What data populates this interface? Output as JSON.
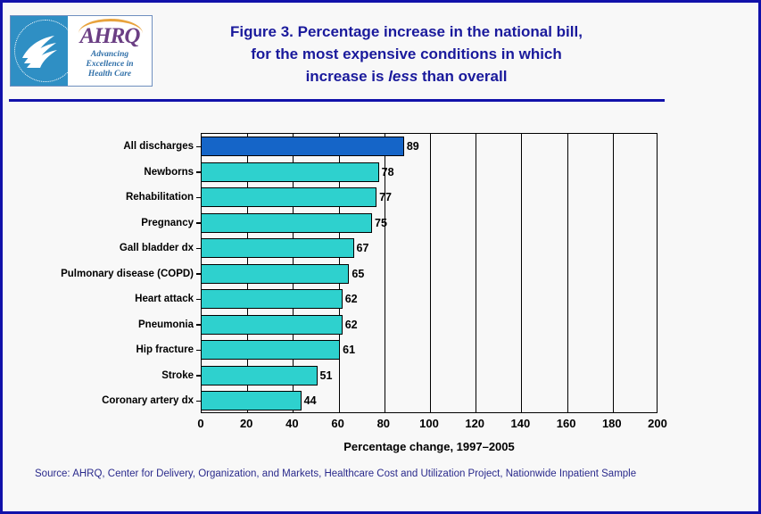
{
  "logo": {
    "name": "ahrq-logo",
    "seal_alt": "DEPARTMENT OF HEALTH & HUMAN SERVICES USA",
    "wordmark": "AHRQ",
    "tagline_line1": "Advancing",
    "tagline_line2": "Excellence in",
    "tagline_line3": "Health Care"
  },
  "title": {
    "line1": "Figure 3. Percentage increase in the national bill,",
    "line2": "for the most expensive conditions in which",
    "line3_pre": "increase is ",
    "line3_italic": "less",
    "line3_post": " than overall"
  },
  "source": "Source: AHRQ, Center for Delivery, Organization, and Markets, Healthcare Cost and Utilization Project, Nationwide Inpatient Sample",
  "colors": {
    "frame_blue": "#1111aa",
    "title_blue": "#1a1a9c",
    "bar_teal": "#2ed1ce",
    "bar_highlight_blue": "#1565c8",
    "source_blue": "#2a2a8c",
    "background": "#f8f8f8"
  },
  "chart_data": {
    "type": "bar",
    "orientation": "horizontal",
    "title": "Figure 3. Percentage increase in the national bill, for the most expensive conditions in which increase is less than overall",
    "xlabel": "Percentage change, 1997–2005",
    "ylabel": "",
    "xlim": [
      0,
      200
    ],
    "xticks": [
      0,
      20,
      40,
      60,
      80,
      100,
      120,
      140,
      160,
      180,
      200
    ],
    "grid": true,
    "legend": false,
    "categories": [
      "All discharges",
      "Newborns",
      "Rehabilitation",
      "Pregnancy",
      "Gall bladder dx",
      "Pulmonary disease (COPD)",
      "Heart attack",
      "Pneumonia",
      "Hip fracture",
      "Stroke",
      "Coronary artery dx"
    ],
    "values": [
      89,
      78,
      77,
      75,
      67,
      65,
      62,
      62,
      61,
      51,
      44
    ],
    "highlight_index": 0,
    "value_labels": [
      "89",
      "78",
      "77",
      "75",
      "67",
      "65",
      "62",
      "62",
      "61",
      "51",
      "44"
    ]
  }
}
